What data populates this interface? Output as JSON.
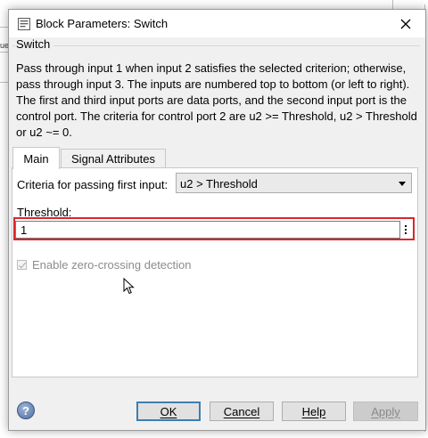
{
  "window": {
    "title": "Block Parameters: Switch",
    "background_fragment": "ue"
  },
  "block": {
    "group_label": "Switch",
    "description": "Pass through input 1 when input 2 satisfies the selected criterion; otherwise, pass through input 3. The inputs are numbered top to bottom (or left to right). The first and third input ports are data ports, and the second input port is the control port. The criteria for control port 2 are u2 >= Threshold, u2 > Threshold or u2 ~= 0."
  },
  "tabs": [
    {
      "label": "Main",
      "active": true
    },
    {
      "label": "Signal Attributes",
      "active": false
    }
  ],
  "main": {
    "criteria_label": "Criteria for passing first input:",
    "criteria_value": "u2 > Threshold",
    "threshold_label": "Threshold:",
    "threshold_value": "1",
    "zero_crossing_label": "Enable zero-crossing detection",
    "zero_crossing_checked": true,
    "zero_crossing_enabled": false
  },
  "buttons": {
    "ok": "OK",
    "cancel": "Cancel",
    "help": "Help",
    "apply": "Apply",
    "help_icon": "?"
  },
  "colors": {
    "highlight": "#d9262c",
    "ok_border": "#3c7fb1"
  },
  "icons": [
    "matlab-icon",
    "close-icon",
    "dropdown-arrow-icon",
    "more-options-icon",
    "help-icon",
    "mouse-cursor-icon"
  ]
}
